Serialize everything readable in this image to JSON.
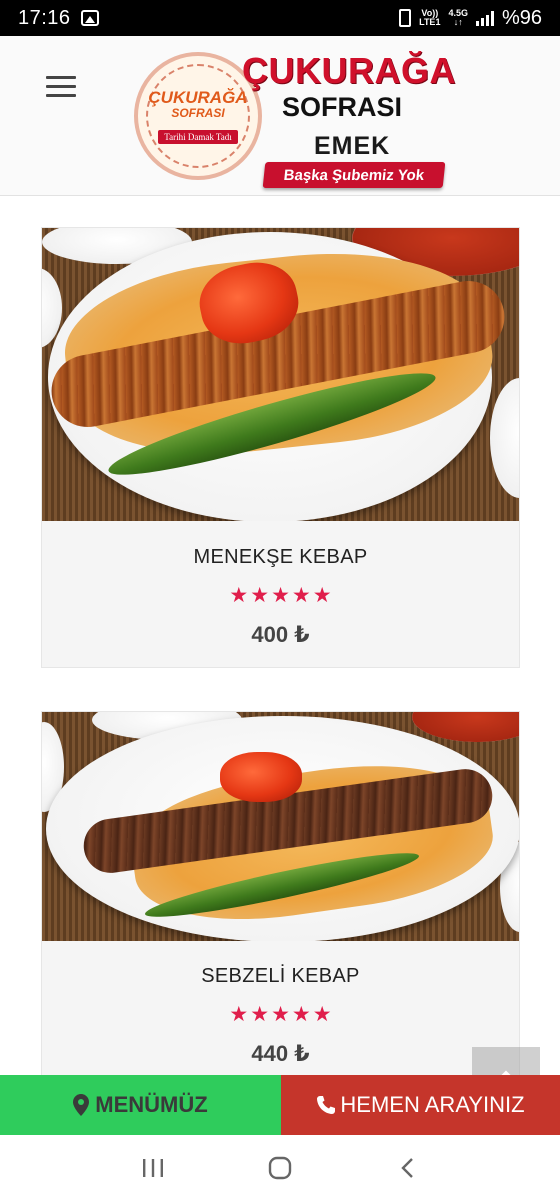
{
  "status_bar": {
    "time": "17:16",
    "network_top": "Vo))",
    "network_bottom": "LTE1",
    "speed": "4.5G",
    "battery": "%96",
    "icons": [
      "gallery-icon",
      "battery-saver-icon",
      "signal-icon"
    ]
  },
  "header": {
    "menu_icon": "hamburger-menu-icon",
    "logo": {
      "badge_name": "ÇUKURAĞA",
      "badge_sub": "SOFRASI",
      "badge_ribbon": "Tarihi Damak Tadı",
      "title": "ÇUKURAĞA",
      "subtitle": "SOFRASI",
      "branch": "EMEK",
      "ribbon": "Başka Şubemiz Yok"
    }
  },
  "products": [
    {
      "name": "MENEKŞE KEBAP",
      "rating": 5,
      "price": "400 ₺"
    },
    {
      "name": "SEBZELİ KEBAP",
      "rating": 5,
      "price": "440 ₺"
    }
  ],
  "action_bar": {
    "menu_label": "MENÜMÜZ",
    "call_label": "HEMEN ARAYINIZ",
    "menu_color": "#2fcc5c",
    "call_color": "#c5352b"
  },
  "colors": {
    "star": "#e01e4b",
    "brand_red": "#d0102b"
  }
}
